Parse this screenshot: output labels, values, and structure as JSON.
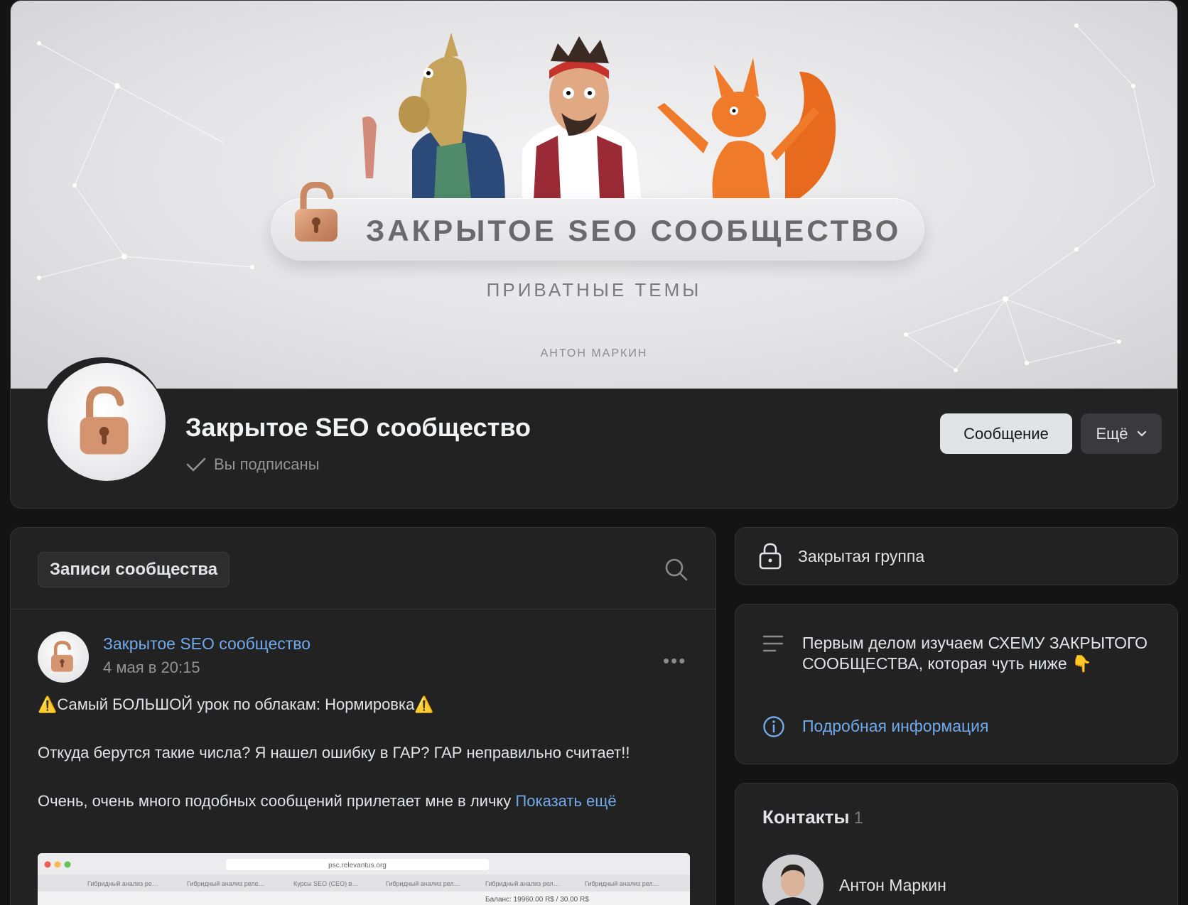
{
  "cover": {
    "title": "ЗАКРЫТОЕ SEO СООБЩЕСТВО",
    "subtitle": "ПРИВАТНЫЕ ТЕМЫ",
    "author": "АНТОН МАРКИН"
  },
  "group": {
    "name": "Закрытое SEO сообщество",
    "subscribed_label": "Вы подписаны",
    "message_button": "Сообщение",
    "more_button": "Ещё"
  },
  "feed": {
    "tab_label": "Записи сообщества",
    "post": {
      "author": "Закрытое SEO сообщество",
      "date": "4 мая в 20:15",
      "paragraph_1": "⚠️Самый БОЛЬШОЙ урок по облакам: Нормировка⚠️",
      "paragraph_2": "Откуда берутся такие числа? Я нашел ошибку в ГАР? ГАР неправильно считает!!",
      "paragraph_3": "Очень, очень много подобных сообщений прилетает мне в личку",
      "show_more": "Показать ещё",
      "screenshot": {
        "url": "psc.relevantus.org",
        "tabs": [
          "Гибридный анализ ре…",
          "Гибридный анализ реле…",
          "Курсы SEO (CEO) в…",
          "Гибридный анализ рел…",
          "Гибридный анализ рел…",
          "Гибридный анализ рел…"
        ],
        "balance": "Баланс: 19960.00 R$ / 30.00 R$"
      }
    }
  },
  "sidebar": {
    "closed_group_label": "Закрытая группа",
    "info_text": "Первым делом изучаем СХЕМУ ЗАКРЫТОГО СООБЩЕСТВА, которая чуть ниже 👇",
    "info_link": "Подробная информация",
    "contacts_title": "Контакты",
    "contacts_count": "1",
    "contact_name": "Антон Маркин"
  },
  "colors": {
    "background": "#141414",
    "card": "#222222",
    "link": "#71aaeb",
    "muted": "#939393",
    "lock_copper": "#c98a63"
  }
}
